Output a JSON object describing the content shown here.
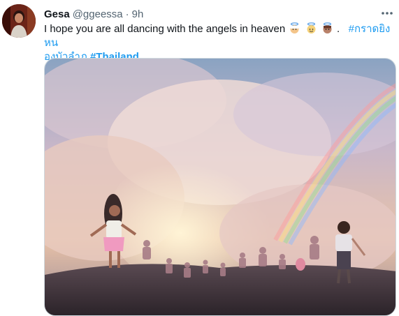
{
  "tweet": {
    "display_name": "Gesa",
    "handle": "@ggeessa",
    "separator": "·",
    "time": "9h",
    "more_icon": "more-horizontal-icon",
    "text_main": "I hope you are all dancing with the angels in heaven",
    "emojis": [
      "angel-face-emoji",
      "angel-face-emoji",
      "angel-face-emoji"
    ],
    "text_period": ".",
    "hashtag_1_line1": "#กราดยิงหน",
    "hashtag_1_line2": "องบัวลำภู",
    "hashtag_2": "#Thailand",
    "media": {
      "description_icon": "image-children-walking-into-clouds-rainbow"
    }
  },
  "colors": {
    "text": "#0f1419",
    "secondary": "#536471",
    "link": "#1d9bf0",
    "border": "#cfd9de"
  }
}
